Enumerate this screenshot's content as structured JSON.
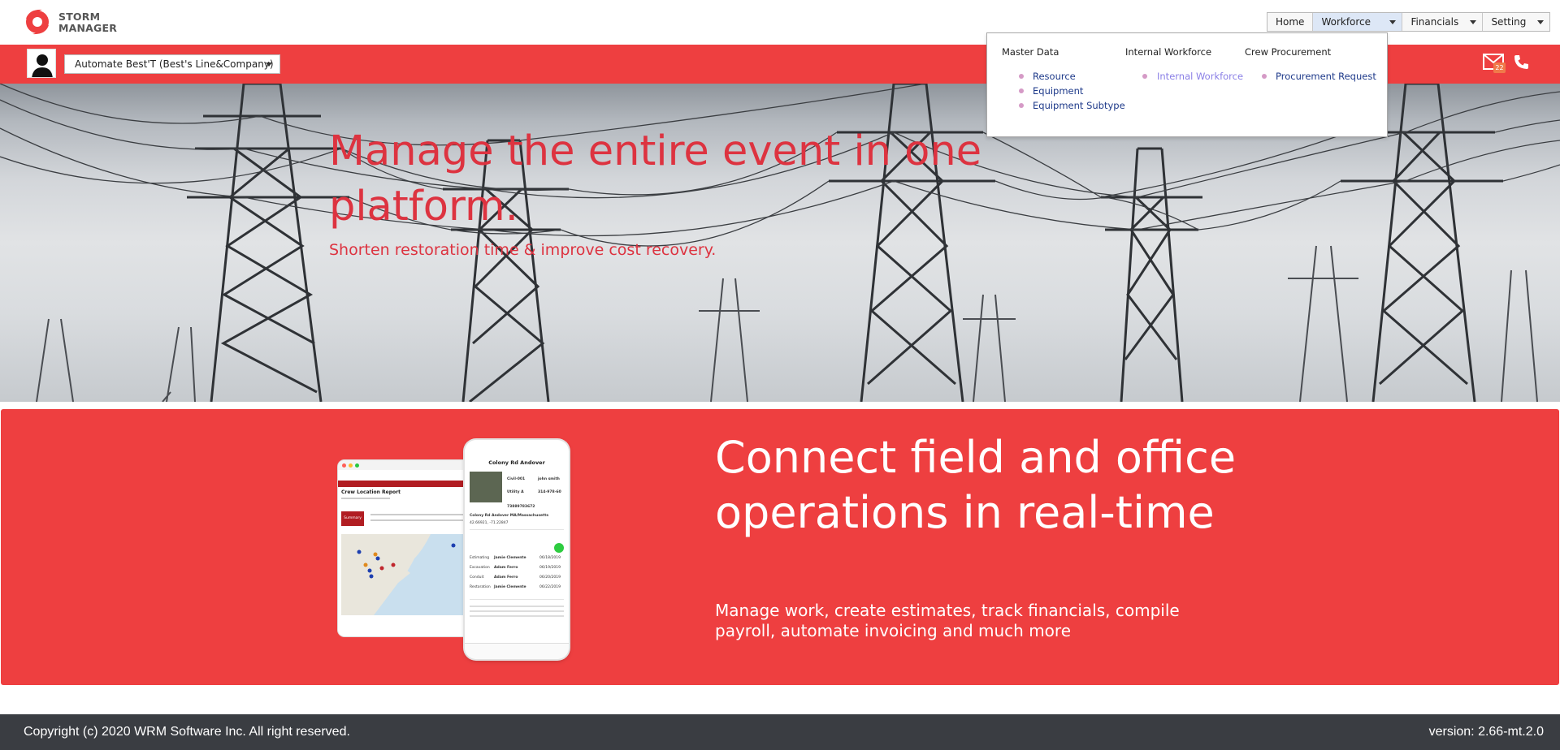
{
  "brand": {
    "line1": "STORM",
    "line2": "MANAGER"
  },
  "topnav": {
    "items": [
      {
        "label": "Home",
        "has_dropdown": false,
        "active": false
      },
      {
        "label": "Workforce",
        "has_dropdown": true,
        "active": true
      },
      {
        "label": "Financials",
        "has_dropdown": true,
        "active": false
      },
      {
        "label": "Setting",
        "has_dropdown": true,
        "active": false
      }
    ]
  },
  "dropdown": {
    "columns": [
      {
        "heading": "Master Data",
        "links": [
          "Resource",
          "Equipment",
          "Equipment Subtype"
        ]
      },
      {
        "heading": "Internal Workforce",
        "links": [
          "Internal Workforce"
        ]
      },
      {
        "heading": "Crew Procurement",
        "links": [
          "Procurement Request"
        ]
      }
    ]
  },
  "userbar": {
    "company": "Automate Best'T (Best's Line&Company)",
    "mail_count": "22"
  },
  "hero": {
    "title": "Manage the entire event in one platform.",
    "subtitle": "Shorten restoration time & improve cost recovery."
  },
  "banner": {
    "title": "Connect field and office operations in real-time",
    "subtitle": "Manage work, create estimates, track financials, compile payroll, automate invoicing and much more",
    "tablet": {
      "report_title": "Crew Location Report",
      "summary_label": "Summary"
    },
    "phone": {
      "title": "Colony Rd Andover",
      "id": "Civil-001",
      "user": "john smith",
      "utility": "Utility A",
      "phone": "314-978-60",
      "ticket": "73889783672",
      "address": "Colony Rd Andover MA/Massachusetts",
      "coords": "42.66921, -71.22847",
      "rows": [
        {
          "type": "Estimating",
          "name": "Jamie Clemente",
          "date": "06/18/2019"
        },
        {
          "type": "Excavation",
          "name": "Adam Ferro",
          "date": "06/19/2019"
        },
        {
          "type": "Conduit",
          "name": "Adam Ferro",
          "date": "06/20/2019"
        },
        {
          "type": "Restoration",
          "name": "Jamie Clemente",
          "date": "06/22/2019"
        }
      ]
    }
  },
  "footer": {
    "copyright": "Copyright (c) 2020 WRM Software Inc. All right reserved.",
    "version": "version: 2.66-mt.2.0"
  },
  "colors": {
    "brand_red": "#ee3f40",
    "hero_text": "#dd3340",
    "footer_bg": "#3a3d42",
    "menu_link": "#1e3a8a",
    "menu_link_current": "#8a7fe6"
  },
  "icons": [
    "storm-manager-logo-icon",
    "caret-down-icon",
    "user-avatar-icon",
    "mail-icon",
    "phone-icon"
  ]
}
